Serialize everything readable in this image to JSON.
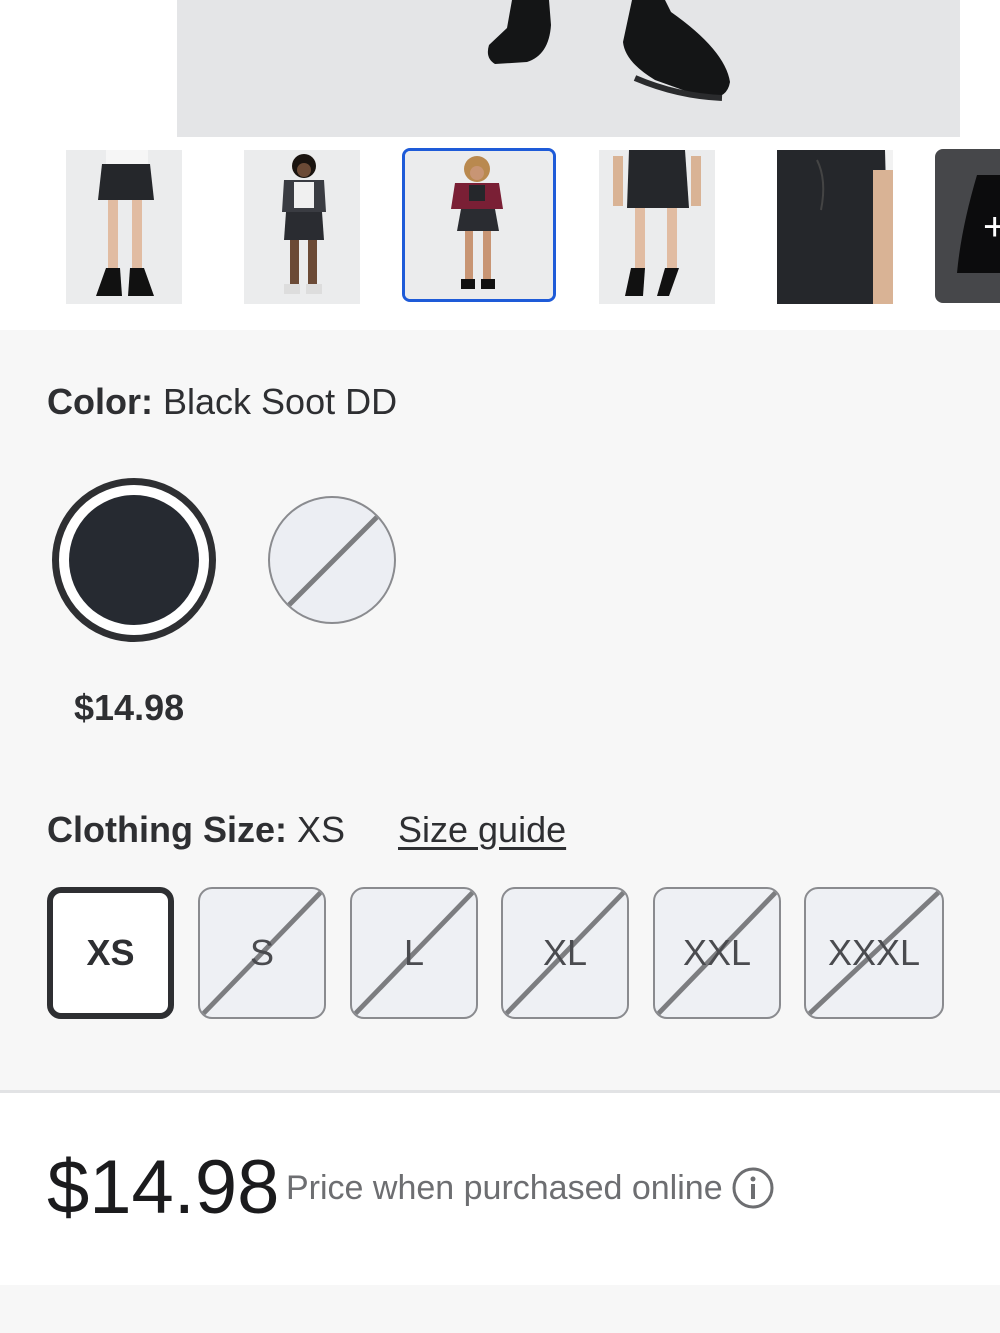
{
  "gallery": {
    "thumbnails": [
      {
        "alt": "front view skirt"
      },
      {
        "alt": "model wearing outfit"
      },
      {
        "alt": "model with burgundy jacket"
      },
      {
        "alt": "back view skirt"
      },
      {
        "alt": "skirt detail close-up"
      }
    ],
    "selected_index": 2,
    "more_icon": "plus-icon"
  },
  "color": {
    "label": "Color:",
    "value": "Black Soot DD",
    "swatches": [
      {
        "name": "Black Soot DD",
        "hex": "#262a31",
        "selected": true,
        "available": true
      },
      {
        "name": "light",
        "hex": "#eceef3",
        "selected": false,
        "available": false
      }
    ],
    "selected_price": "$14.98"
  },
  "size": {
    "label": "Clothing Size:",
    "value": "XS",
    "guide_link": "Size guide",
    "options": [
      {
        "label": "XS",
        "selected": true,
        "available": true
      },
      {
        "label": "S",
        "selected": false,
        "available": false
      },
      {
        "label": "L",
        "selected": false,
        "available": false
      },
      {
        "label": "XL",
        "selected": false,
        "available": false
      },
      {
        "label": "XXL",
        "selected": false,
        "available": false
      },
      {
        "label": "XXXL",
        "selected": false,
        "available": false
      }
    ]
  },
  "pricing": {
    "price": "$14.98",
    "note": "Price when purchased online",
    "info_icon": "info-icon"
  },
  "colors": {
    "selected_outline": "#1e5bd8",
    "text": "#2e2f32",
    "muted": "#6d6e71"
  }
}
